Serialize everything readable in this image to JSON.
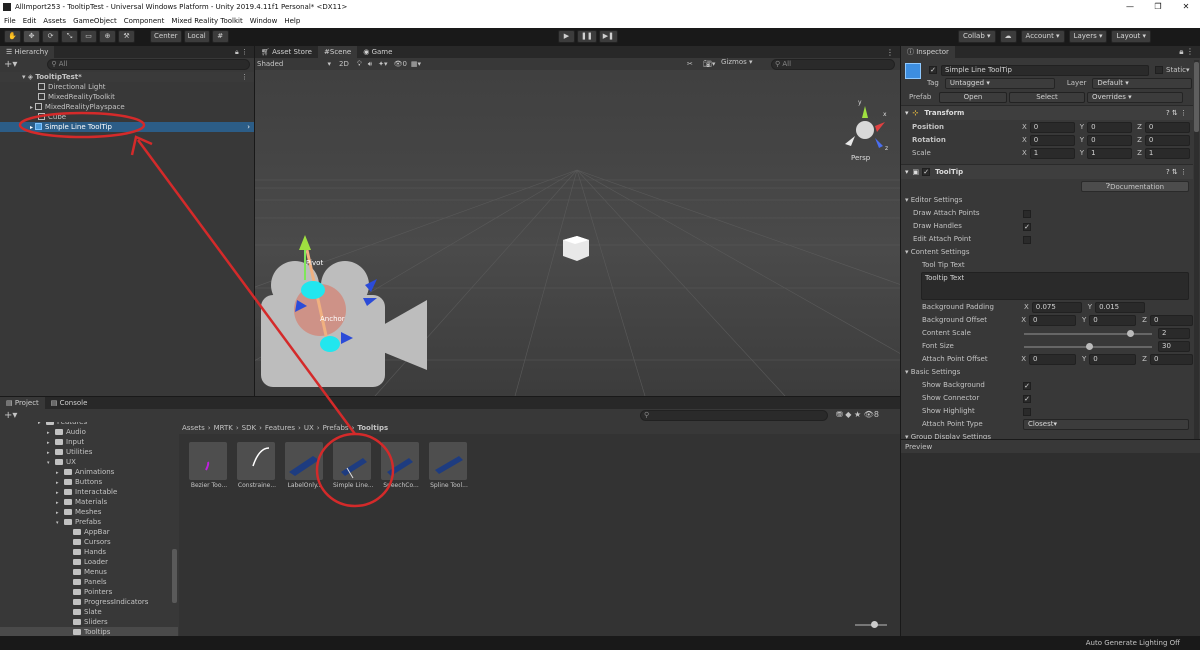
{
  "title_bar": {
    "title": "AllImport253 - TooltipTest - Universal Windows Platform - Unity 2019.4.11f1 Personal* <DX11>"
  },
  "menu": [
    "File",
    "Edit",
    "Assets",
    "GameObject",
    "Component",
    "Mixed Reality Toolkit",
    "Window",
    "Help"
  ],
  "toolbar": {
    "center_label": "Center",
    "local_label": "Local",
    "collab_label": "Collab",
    "account_label": "Account",
    "layers_label": "Layers",
    "layout_label": "Layout"
  },
  "hierarchy": {
    "tab_label": "Hierarchy",
    "search_placeholder": "All",
    "scene_name": "TooltipTest*",
    "items": [
      {
        "label": "Directional Light"
      },
      {
        "label": "MixedRealityToolkit"
      },
      {
        "label": "MixedRealityPlayspace"
      },
      {
        "label": "Cube"
      },
      {
        "label": "Simple Line ToolTip"
      }
    ]
  },
  "scene": {
    "tabs": [
      "Asset Store",
      "Scene",
      "Game"
    ],
    "shading_mode": "Shaded",
    "mode_2d": "2D",
    "effects_count": "0",
    "gizmos_label": "Gizmos",
    "search_placeholder": "All",
    "persp_label": "Persp",
    "pivot_label": "Pivot",
    "anchor_label": "Anchor"
  },
  "project": {
    "tabs": [
      "Project",
      "Console"
    ],
    "hidden_count": "8",
    "tree": [
      {
        "label": "Features",
        "indent": 0
      },
      {
        "label": "Audio",
        "indent": 1
      },
      {
        "label": "Input",
        "indent": 1
      },
      {
        "label": "Utilities",
        "indent": 1
      },
      {
        "label": "UX",
        "indent": 1
      },
      {
        "label": "Animations",
        "indent": 2
      },
      {
        "label": "Buttons",
        "indent": 2
      },
      {
        "label": "Interactable",
        "indent": 2
      },
      {
        "label": "Materials",
        "indent": 2
      },
      {
        "label": "Meshes",
        "indent": 2
      },
      {
        "label": "Prefabs",
        "indent": 2
      },
      {
        "label": "AppBar",
        "indent": 3
      },
      {
        "label": "Cursors",
        "indent": 3
      },
      {
        "label": "Hands",
        "indent": 3
      },
      {
        "label": "Loader",
        "indent": 3
      },
      {
        "label": "Menus",
        "indent": 3
      },
      {
        "label": "Panels",
        "indent": 3
      },
      {
        "label": "Pointers",
        "indent": 3
      },
      {
        "label": "ProgressIndicators",
        "indent": 3
      },
      {
        "label": "Slate",
        "indent": 3
      },
      {
        "label": "Sliders",
        "indent": 3
      },
      {
        "label": "Tooltips",
        "indent": 3
      }
    ],
    "breadcrumb": [
      "Assets",
      "MRTK",
      "SDK",
      "Features",
      "UX",
      "Prefabs",
      "Tooltips"
    ],
    "assets": [
      {
        "label": "Bezier Too..."
      },
      {
        "label": "Constraine..."
      },
      {
        "label": "LabelOnly..."
      },
      {
        "label": "Simple Line..."
      },
      {
        "label": "SpeechCo..."
      },
      {
        "label": "Spline Tool..."
      }
    ]
  },
  "inspector": {
    "tab_label": "Inspector",
    "object_name": "Simple Line ToolTip",
    "static_label": "Static",
    "tag_label": "Tag",
    "tag_value": "Untagged",
    "layer_label": "Layer",
    "layer_value": "Default",
    "prefab_label": "Prefab",
    "open_label": "Open",
    "select_label": "Select",
    "overrides_label": "Overrides",
    "transform": {
      "header": "Transform",
      "rows": [
        {
          "label": "Position",
          "x": "0",
          "y": "0",
          "z": "0"
        },
        {
          "label": "Rotation",
          "x": "0",
          "y": "0",
          "z": "0"
        },
        {
          "label": "Scale",
          "x": "1",
          "y": "1",
          "z": "1"
        }
      ]
    },
    "tooltip": {
      "header": "ToolTip",
      "documentation_label": "Documentation",
      "editor_settings": "Editor Settings",
      "draw_attach_points": "Draw Attach Points",
      "draw_handles": "Draw Handles",
      "edit_attach_point": "Edit Attach Point",
      "content_settings": "Content Settings",
      "tool_tip_text_label": "Tool Tip Text",
      "tool_tip_text_value": "Tooltip Text",
      "background_padding_label": "Background Padding",
      "background_padding_x": "0.075",
      "background_padding_y": "0.015",
      "background_offset_label": "Background Offset",
      "background_offset": {
        "x": "0",
        "y": "0",
        "z": "0"
      },
      "content_scale_label": "Content Scale",
      "content_scale_value": "2",
      "content_scale_fraction": 0.85,
      "font_size_label": "Font Size",
      "font_size_value": "30",
      "font_size_fraction": 0.51,
      "attach_point_offset_label": "Attach Point Offset",
      "attach_point_offset": {
        "x": "0",
        "y": "0",
        "z": "0"
      },
      "basic_settings": "Basic Settings",
      "show_background": "Show Background",
      "show_connector": "Show Connector",
      "show_highlight": "Show Highlight",
      "attach_point_type_label": "Attach Point Type",
      "attach_point_type_value": "Closest",
      "group_display_settings": "Group Display Settings"
    },
    "preview_label": "Preview"
  },
  "status_bar": {
    "text": "Auto Generate Lighting Off"
  },
  "colors": {
    "selection": "#2c5d87",
    "annotation_red": "#d42a2a",
    "background": "#383838"
  }
}
